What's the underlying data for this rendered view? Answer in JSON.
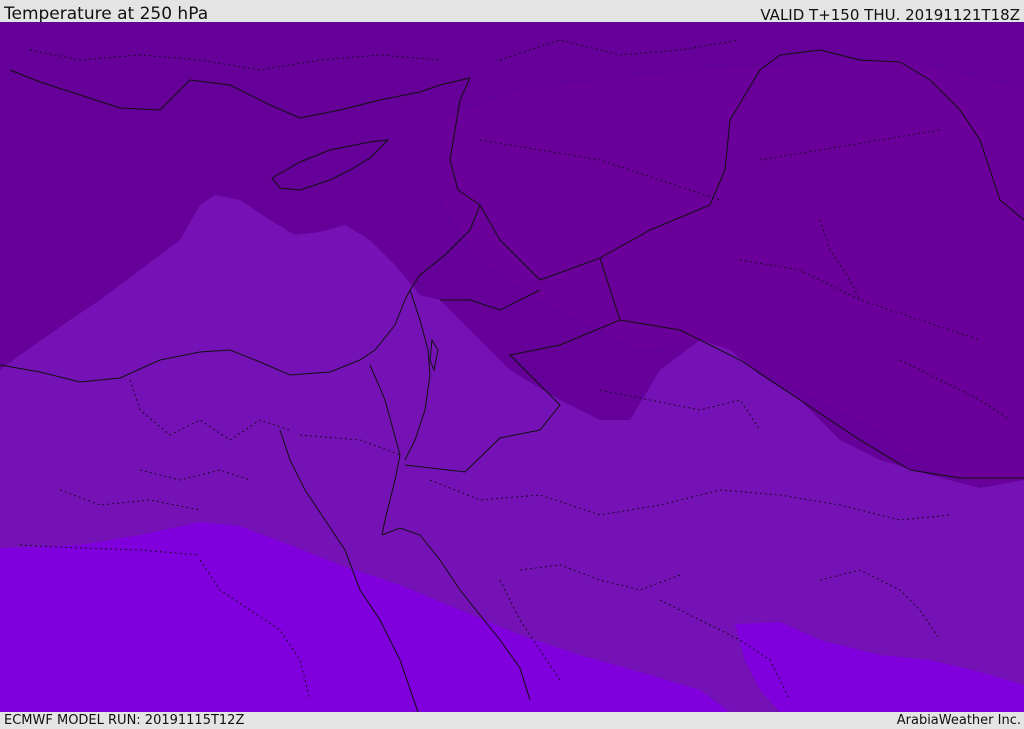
{
  "header": {
    "title": "Temperature at 250 hPa",
    "valid_time": "VALID T+150 THU. 20191121T18Z"
  },
  "footer": {
    "model_run": "ECMWF MODEL RUN: 20191115T12Z",
    "credit": "ArabiaWeather Inc."
  },
  "map": {
    "region": "Eastern Mediterranean / Middle East",
    "colors": {
      "band_darkest": "#650098",
      "band_dark": "#6a0099",
      "band_mid": "#7512b5",
      "band_bright": "#7f00dd",
      "coastline": "#111111",
      "border_dotted": "#1a0a2a"
    },
    "temperature_bands": [
      "band_darkest",
      "band_dark",
      "band_mid",
      "band_bright"
    ]
  }
}
